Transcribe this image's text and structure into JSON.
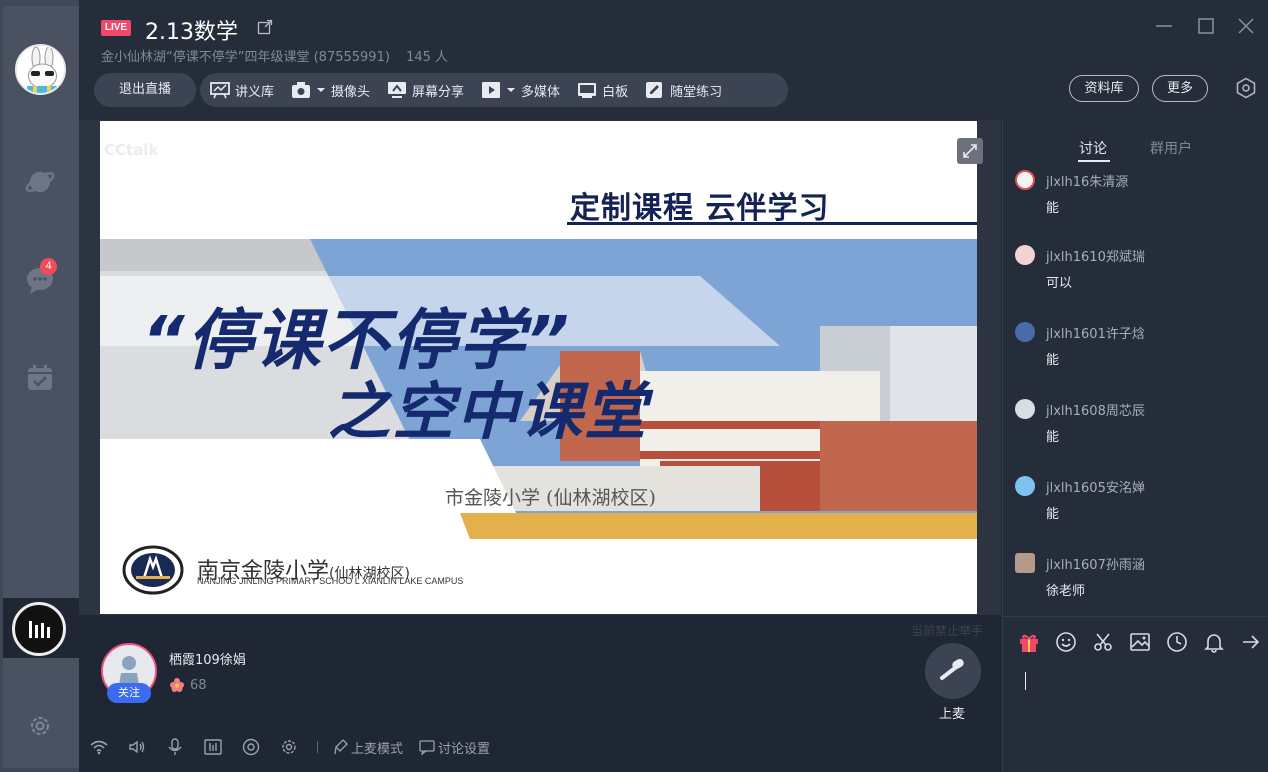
{
  "header": {
    "live_label": "LIVE",
    "title": "2.13数学",
    "subtitle": "金小仙林湖“停课不停学”四年级课堂 (87555991)",
    "member_count": "145 人"
  },
  "toolbar": {
    "exit_label": "退出直播",
    "items": [
      {
        "label": "讲义库",
        "icon": "slides-icon"
      },
      {
        "label": "摄像头",
        "icon": "camera-icon"
      },
      {
        "label": "屏幕分享",
        "icon": "screen-share-icon"
      },
      {
        "label": "多媒体",
        "icon": "media-icon"
      },
      {
        "label": "白板",
        "icon": "whiteboard-icon"
      },
      {
        "label": "随堂练习",
        "icon": "exercise-icon"
      }
    ],
    "resource_label": "资料库",
    "more_label": "更多"
  },
  "rail": {
    "badge_count": "4"
  },
  "slide": {
    "watermark": "CCtalk",
    "slogan": "定制课程 云伴学习",
    "title_line1": "“停课不停学”",
    "title_line2": "之空中课堂",
    "sign_text": "市金陵小学 (仙林湖校区)",
    "school_name": "南京金陵小学",
    "school_branch": "(仙林湖校区)",
    "school_english": "NANJING JINLING PRIMARY SCHOO L XIANLIN LAKE CAMPUS"
  },
  "chat": {
    "tab_discuss": "讨论",
    "tab_members": "群用户",
    "messages": [
      {
        "name": "jlxlh16朱清源",
        "text": "能"
      },
      {
        "name": "jlxlh1610郑斌瑞",
        "text": "可以"
      },
      {
        "name": "jlxlh1601许子焓",
        "text": "能"
      },
      {
        "name": "jlxlh1608周芯辰",
        "text": "能"
      },
      {
        "name": "jlxlh1605安洺婵",
        "text": "能"
      },
      {
        "name": "jlxlh1607孙雨涵",
        "text": "徐老师"
      }
    ]
  },
  "presenter": {
    "name": "栖霞109徐娟",
    "follow_label": "关注",
    "likes": "68",
    "forbid_note": "当前禁止举手",
    "mic_label": "上麦"
  },
  "bottom_bar": {
    "mic_mode_label": "上麦模式",
    "discussion_settings_label": "讨论设置"
  },
  "colors": {
    "live": "#f0486a",
    "accent_blue": "#3a6bf0",
    "bg_dark": "#1f2634",
    "panel": "#262d3a"
  }
}
